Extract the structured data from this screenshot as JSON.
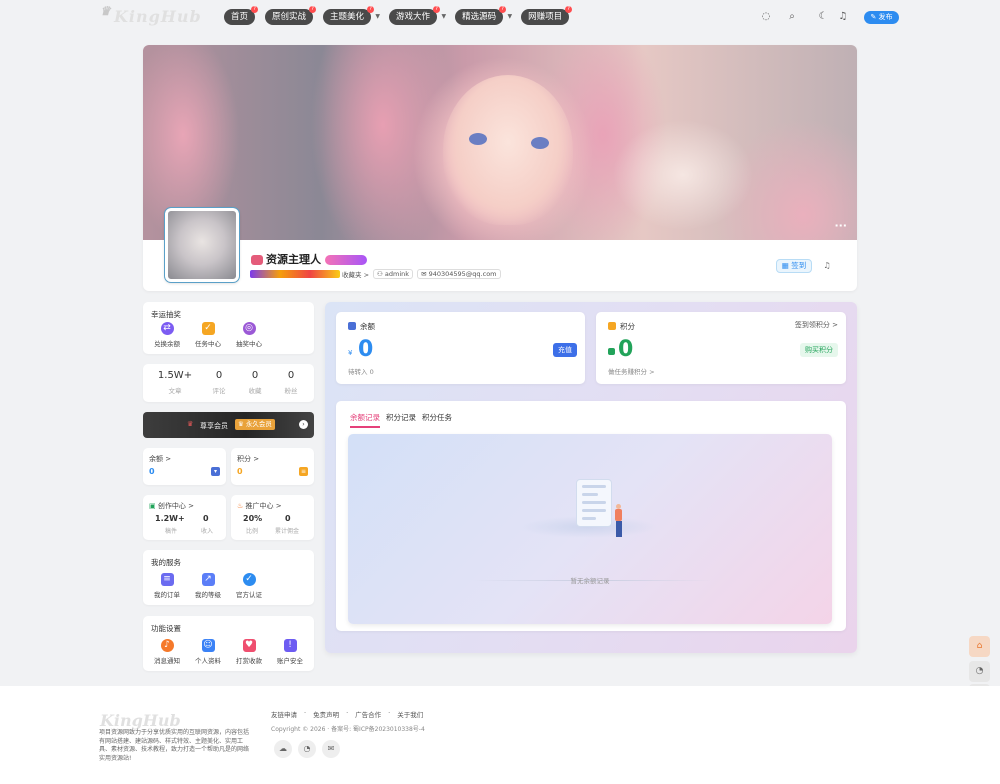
{
  "header": {
    "logo_text": "KingHub",
    "nav": [
      {
        "label": "首页",
        "has_dropdown": false
      },
      {
        "label": "原创实战",
        "has_dropdown": false
      },
      {
        "label": "主题美化",
        "has_dropdown": true
      },
      {
        "label": "游戏大作",
        "has_dropdown": true
      },
      {
        "label": "精选源码",
        "has_dropdown": true
      },
      {
        "label": "网赚项目",
        "has_dropdown": false
      }
    ],
    "nav_dot_label": "?",
    "publish_label": "✎ 发布",
    "icons": [
      "bulb-icon",
      "search-icon",
      "moon-icon",
      "bell-icon"
    ]
  },
  "profile": {
    "username": "资源主理人",
    "favorites_text": "收藏夹 >",
    "role_chip": "admink",
    "email": "940304595@qq.com",
    "signin_label": "签到",
    "more_label": "···"
  },
  "lottery": {
    "title": "幸运抽奖",
    "items": [
      {
        "label": "兑换余额",
        "icon": "exchange-icon",
        "color": "#7c5cf2"
      },
      {
        "label": "任务中心",
        "icon": "task-icon",
        "color": "#f5a623"
      },
      {
        "label": "抽奖中心",
        "icon": "lottery-icon",
        "color": "#9b59d6"
      }
    ]
  },
  "stats": [
    {
      "value": "1.5W+",
      "label": "文章"
    },
    {
      "value": "0",
      "label": "评论"
    },
    {
      "value": "0",
      "label": "收藏"
    },
    {
      "value": "0",
      "label": "粉丝"
    }
  ],
  "vip": {
    "label": "尊享会员",
    "badge": "♛ 永久会员"
  },
  "mini": {
    "balance": {
      "title": "余额 >",
      "value": "0"
    },
    "points": {
      "title": "积分 >",
      "value": "0"
    },
    "creator": {
      "title": "创作中心 >",
      "v1": "1.2W+",
      "l1": "稿件",
      "v2": "0",
      "l2": "收入"
    },
    "promo": {
      "title": "推广中心 >",
      "v1": "20%",
      "l1": "比例",
      "v2": "0",
      "l2": "累计佣金"
    }
  },
  "services": {
    "title": "我的服务",
    "items": [
      {
        "label": "我的订单",
        "icon": "order-icon",
        "color": "#6b6bf0"
      },
      {
        "label": "我的等级",
        "icon": "level-icon",
        "color": "#5b7ef7"
      },
      {
        "label": "官方认证",
        "icon": "verified-icon",
        "color": "#2d8cf0"
      }
    ]
  },
  "settings": {
    "title": "功能设置",
    "items": [
      {
        "label": "消息通知",
        "icon": "notify-icon",
        "color": "#f5792a"
      },
      {
        "label": "个人资料",
        "icon": "profile-icon",
        "color": "#3b82f6"
      },
      {
        "label": "打赏收款",
        "icon": "reward-icon",
        "color": "#ef4f6f"
      },
      {
        "label": "账户安全",
        "icon": "security-icon",
        "color": "#6d5cf2"
      }
    ]
  },
  "wallet": {
    "balance": {
      "title": "余额",
      "currency": "¥",
      "value": "0",
      "sub": "待转入 0",
      "action": "充值"
    },
    "points": {
      "title": "积分",
      "value": "0",
      "sub": "做任务赚积分 >",
      "action": "购买积分",
      "link": "签到领积分 >"
    }
  },
  "records": {
    "tabs": [
      "余额记录",
      "积分记录",
      "积分任务"
    ],
    "active_tab": 0,
    "empty_text": "暂无余额记录"
  },
  "float_buttons": [
    "home-icon",
    "qq-icon",
    "wechat-icon",
    "qrcode-icon"
  ],
  "footer": {
    "logo_text": "KingHub",
    "description": "项目资源网致力于分享优质实用的互联网资源，内容包括有网站搭建、建站源码、样式特效、主题美化、实用工具、素材资源、技术教程，致力打造一个帮助凡是的网络实用资源站!",
    "links": [
      "友链申请",
      "·",
      "免责声明",
      "·",
      "广告合作",
      "·",
      "关于我们"
    ],
    "copyright": "Copyright © 2026 · 备案号: 蜀ICP备2023010338号-4"
  }
}
